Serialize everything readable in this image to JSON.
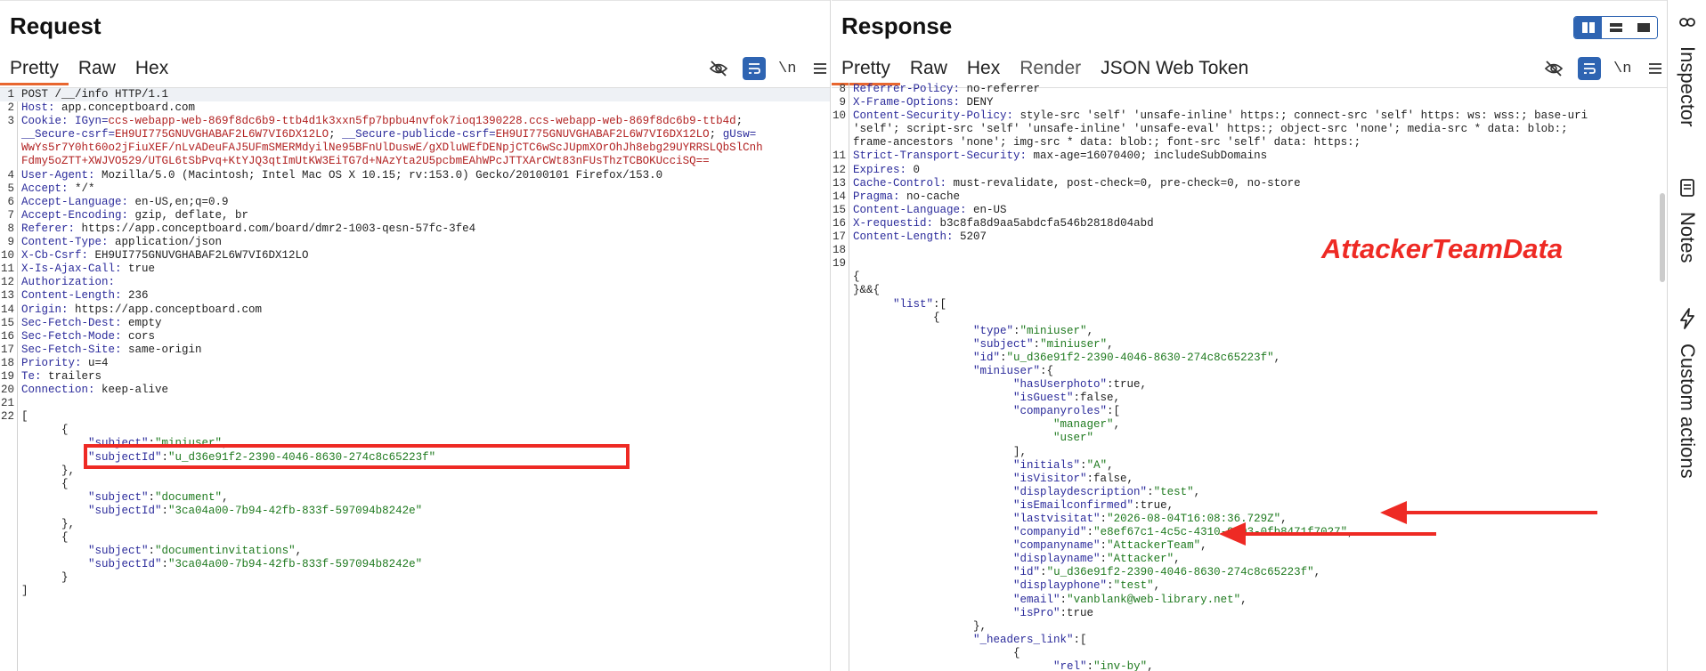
{
  "request": {
    "title": "Request",
    "tabs": [
      "Pretty",
      "Raw",
      "Hex"
    ],
    "newline_label": "\\n",
    "lines": [
      {
        "n": "1",
        "segs": [
          [
            "hv",
            "POST /__/info HTTP/1.1"
          ]
        ],
        "hl": true
      },
      {
        "n": "2",
        "segs": [
          [
            "hk",
            "Host: "
          ],
          [
            "hv",
            "app.conceptboard.com"
          ]
        ]
      },
      {
        "n": "3",
        "segs": [
          [
            "hk",
            "Cookie: "
          ],
          [
            "ck",
            "IGyn="
          ],
          [
            "cv",
            "ccs-webapp-web-869f8dc6b9-ttb4d1k3xxn5fp7bpbu4nvfok7ioq1390228.ccs-webapp-web-869f8dc6b9-ttb4d"
          ],
          [
            "hv",
            "; "
          ]
        ]
      },
      {
        "n": "",
        "segs": [
          [
            "ck",
            "__Secure-csrf="
          ],
          [
            "cv",
            "EH9UI775GNUVGHABAF2L6W7VI6DX12LO"
          ],
          [
            "hv",
            "; "
          ],
          [
            "ck",
            "__Secure-publicde-csrf="
          ],
          [
            "cv",
            "EH9UI775GNUVGHABAF2L6W7VI6DX12LO"
          ],
          [
            "hv",
            "; "
          ],
          [
            "ck",
            "gUsw="
          ]
        ]
      },
      {
        "n": "",
        "segs": [
          [
            "cv",
            "WwYs5r7Y0ht60o2jFiuXEF/nLvADeuFAJ5UFmSMERMdyilNe95BFnUlDuswE/gXDluWEfDENpjCTC6wScJUpmXOrOhJh8ebg29UYRRSLQbSlCnh"
          ]
        ]
      },
      {
        "n": "",
        "segs": [
          [
            "cv",
            "Fdmy5oZTT+XWJVO529/UTGL6tSbPvq+KtYJQ3qtImUtKW3EiTG7d+NAzYta2U5pcbmEAhWPcJTTXArCWt83nFUsThzTCBOKUcciSQ=="
          ]
        ]
      },
      {
        "n": "4",
        "segs": [
          [
            "hk",
            "User-Agent: "
          ],
          [
            "hv",
            "Mozilla/5.0 (Macintosh; Intel Mac OS X 10.15; rv:153.0) Gecko/20100101 Firefox/153.0"
          ]
        ]
      },
      {
        "n": "5",
        "segs": [
          [
            "hk",
            "Accept: "
          ],
          [
            "hv",
            "*/*"
          ]
        ]
      },
      {
        "n": "6",
        "segs": [
          [
            "hk",
            "Accept-Language: "
          ],
          [
            "hv",
            "en-US,en;q=0.9"
          ]
        ]
      },
      {
        "n": "7",
        "segs": [
          [
            "hk",
            "Accept-Encoding: "
          ],
          [
            "hv",
            "gzip, deflate, br"
          ]
        ]
      },
      {
        "n": "8",
        "segs": [
          [
            "hk",
            "Referer: "
          ],
          [
            "hv",
            "https://app.conceptboard.com/board/dmr2-1003-qesn-57fc-3fe4"
          ]
        ]
      },
      {
        "n": "9",
        "segs": [
          [
            "hk",
            "Content-Type: "
          ],
          [
            "hv",
            "application/json"
          ]
        ]
      },
      {
        "n": "10",
        "segs": [
          [
            "hk",
            "X-Cb-Csrf: "
          ],
          [
            "hv",
            "EH9UI775GNUVGHABAF2L6W7VI6DX12LO"
          ]
        ]
      },
      {
        "n": "11",
        "segs": [
          [
            "hk",
            "X-Is-Ajax-Call: "
          ],
          [
            "hv",
            "true"
          ]
        ]
      },
      {
        "n": "12",
        "segs": [
          [
            "hk",
            "Authorization: "
          ]
        ]
      },
      {
        "n": "13",
        "segs": [
          [
            "hk",
            "Content-Length: "
          ],
          [
            "hv",
            "236"
          ]
        ]
      },
      {
        "n": "14",
        "segs": [
          [
            "hk",
            "Origin: "
          ],
          [
            "hv",
            "https://app.conceptboard.com"
          ]
        ]
      },
      {
        "n": "15",
        "segs": [
          [
            "hk",
            "Sec-Fetch-Dest: "
          ],
          [
            "hv",
            "empty"
          ]
        ]
      },
      {
        "n": "16",
        "segs": [
          [
            "hk",
            "Sec-Fetch-Mode: "
          ],
          [
            "hv",
            "cors"
          ]
        ]
      },
      {
        "n": "17",
        "segs": [
          [
            "hk",
            "Sec-Fetch-Site: "
          ],
          [
            "hv",
            "same-origin"
          ]
        ]
      },
      {
        "n": "18",
        "segs": [
          [
            "hk",
            "Priority: "
          ],
          [
            "hv",
            "u=4"
          ]
        ]
      },
      {
        "n": "19",
        "segs": [
          [
            "hk",
            "Te: "
          ],
          [
            "hv",
            "trailers"
          ]
        ]
      },
      {
        "n": "20",
        "segs": [
          [
            "hk",
            "Connection: "
          ],
          [
            "hv",
            "keep-alive"
          ]
        ]
      },
      {
        "n": "21",
        "segs": []
      },
      {
        "n": "22",
        "segs": [
          [
            "jv",
            "["
          ]
        ]
      },
      {
        "n": "",
        "segs": [
          [
            "jv",
            "      {"
          ]
        ]
      },
      {
        "n": "",
        "segs": [
          [
            "jk",
            "          \"subject\""
          ],
          [
            "jv",
            ":"
          ],
          [
            "js",
            "\"miniuser\""
          ],
          [
            "jv",
            ","
          ]
        ]
      },
      {
        "n": "",
        "segs": [
          [
            "jk",
            "          \"subjectId\""
          ],
          [
            "jv",
            ":"
          ],
          [
            "js",
            "\"u_d36e91f2-2390-4046-8630-274c8c65223f\""
          ]
        ]
      },
      {
        "n": "",
        "segs": [
          [
            "jv",
            "      },"
          ]
        ]
      },
      {
        "n": "",
        "segs": [
          [
            "jv",
            "      {"
          ]
        ]
      },
      {
        "n": "",
        "segs": [
          [
            "jk",
            "          \"subject\""
          ],
          [
            "jv",
            ":"
          ],
          [
            "js",
            "\"document\""
          ],
          [
            "jv",
            ","
          ]
        ]
      },
      {
        "n": "",
        "segs": [
          [
            "jk",
            "          \"subjectId\""
          ],
          [
            "jv",
            ":"
          ],
          [
            "js",
            "\"3ca04a00-7b94-42fb-833f-597094b8242e\""
          ]
        ]
      },
      {
        "n": "",
        "segs": [
          [
            "jv",
            "      },"
          ]
        ]
      },
      {
        "n": "",
        "segs": [
          [
            "jv",
            "      {"
          ]
        ]
      },
      {
        "n": "",
        "segs": [
          [
            "jk",
            "          \"subject\""
          ],
          [
            "jv",
            ":"
          ],
          [
            "js",
            "\"documentinvitations\""
          ],
          [
            "jv",
            ","
          ]
        ]
      },
      {
        "n": "",
        "segs": [
          [
            "jk",
            "          \"subjectId\""
          ],
          [
            "jv",
            ":"
          ],
          [
            "js",
            "\"3ca04a00-7b94-42fb-833f-597094b8242e\""
          ]
        ]
      },
      {
        "n": "",
        "segs": [
          [
            "jv",
            "      }"
          ]
        ]
      },
      {
        "n": "",
        "segs": [
          [
            "jv",
            "]"
          ]
        ]
      }
    ]
  },
  "response": {
    "title": "Response",
    "tabs": [
      "Pretty",
      "Raw",
      "Hex",
      "Render",
      "JSON Web Token"
    ],
    "newline_label": "\\n",
    "annotation": "AttackerTeamData",
    "lines": [
      {
        "n": "8",
        "segs": [
          [
            "hk",
            "Referrer-Policy: "
          ],
          [
            "hv",
            "no-referrer"
          ]
        ]
      },
      {
        "n": "9",
        "segs": [
          [
            "hk",
            "X-Frame-Options: "
          ],
          [
            "hv",
            "DENY"
          ]
        ]
      },
      {
        "n": "10",
        "segs": [
          [
            "hk",
            "Content-Security-Policy: "
          ],
          [
            "hv",
            "style-src 'self' 'unsafe-inline' https:; connect-src 'self' https: ws: wss:; base-uri"
          ]
        ]
      },
      {
        "n": "",
        "segs": [
          [
            "hv",
            "'self'; script-src 'self' 'unsafe-inline' 'unsafe-eval' https:; object-src 'none'; media-src * data: blob:;"
          ]
        ]
      },
      {
        "n": "",
        "segs": [
          [
            "hv",
            "frame-ancestors 'none'; img-src * data: blob:; font-src 'self' data: https:;"
          ]
        ]
      },
      {
        "n": "11",
        "segs": [
          [
            "hk",
            "Strict-Transport-Security: "
          ],
          [
            "hv",
            "max-age=16070400; includeSubDomains"
          ]
        ]
      },
      {
        "n": "12",
        "segs": [
          [
            "hk",
            "Expires: "
          ],
          [
            "hv",
            "0"
          ]
        ]
      },
      {
        "n": "13",
        "segs": [
          [
            "hk",
            "Cache-Control: "
          ],
          [
            "hv",
            "must-revalidate, post-check=0, pre-check=0, no-store"
          ]
        ]
      },
      {
        "n": "14",
        "segs": [
          [
            "hk",
            "Pragma: "
          ],
          [
            "hv",
            "no-cache"
          ]
        ]
      },
      {
        "n": "15",
        "segs": [
          [
            "hk",
            "Content-Language: "
          ],
          [
            "hv",
            "en-US"
          ]
        ]
      },
      {
        "n": "16",
        "segs": [
          [
            "hk",
            "X-requestid: "
          ],
          [
            "hv",
            "b3c8fa8d9aa5abdcfa546b2818d04abd"
          ]
        ]
      },
      {
        "n": "17",
        "segs": [
          [
            "hk",
            "Content-Length: "
          ],
          [
            "hv",
            "5207"
          ]
        ]
      },
      {
        "n": "18",
        "segs": []
      },
      {
        "n": "19",
        "segs": []
      },
      {
        "n": "",
        "segs": [
          [
            "jv",
            "{"
          ]
        ]
      },
      {
        "n": "",
        "segs": [
          [
            "jv",
            "}&&{"
          ]
        ]
      },
      {
        "n": "",
        "segs": [
          [
            "jk",
            "      \"list\""
          ],
          [
            "jv",
            ":["
          ]
        ]
      },
      {
        "n": "",
        "segs": [
          [
            "jv",
            "            {"
          ]
        ]
      },
      {
        "n": "",
        "segs": [
          [
            "jk",
            "                  \"type\""
          ],
          [
            "jv",
            ":"
          ],
          [
            "js",
            "\"miniuser\""
          ],
          [
            "jv",
            ","
          ]
        ]
      },
      {
        "n": "",
        "segs": [
          [
            "jk",
            "                  \"subject\""
          ],
          [
            "jv",
            ":"
          ],
          [
            "js",
            "\"miniuser\""
          ],
          [
            "jv",
            ","
          ]
        ]
      },
      {
        "n": "",
        "segs": [
          [
            "jk",
            "                  \"id\""
          ],
          [
            "jv",
            ":"
          ],
          [
            "js",
            "\"u_d36e91f2-2390-4046-8630-274c8c65223f\""
          ],
          [
            "jv",
            ","
          ]
        ]
      },
      {
        "n": "",
        "segs": [
          [
            "jk",
            "                  \"miniuser\""
          ],
          [
            "jv",
            ":{"
          ]
        ]
      },
      {
        "n": "",
        "segs": [
          [
            "jk",
            "                        \"hasUserphoto\""
          ],
          [
            "jv",
            ":true,"
          ]
        ]
      },
      {
        "n": "",
        "segs": [
          [
            "jk",
            "                        \"isGuest\""
          ],
          [
            "jv",
            ":false,"
          ]
        ]
      },
      {
        "n": "",
        "segs": [
          [
            "jk",
            "                        \"companyroles\""
          ],
          [
            "jv",
            ":["
          ]
        ]
      },
      {
        "n": "",
        "segs": [
          [
            "js",
            "                              \"manager\""
          ],
          [
            "jv",
            ","
          ]
        ]
      },
      {
        "n": "",
        "segs": [
          [
            "js",
            "                              \"user\""
          ]
        ]
      },
      {
        "n": "",
        "segs": [
          [
            "jv",
            "                        ],"
          ]
        ]
      },
      {
        "n": "",
        "segs": [
          [
            "jk",
            "                        \"initials\""
          ],
          [
            "jv",
            ":"
          ],
          [
            "js",
            "\"A\""
          ],
          [
            "jv",
            ","
          ]
        ]
      },
      {
        "n": "",
        "segs": [
          [
            "jk",
            "                        \"isVisitor\""
          ],
          [
            "jv",
            ":false,"
          ]
        ]
      },
      {
        "n": "",
        "segs": [
          [
            "jk",
            "                        \"displaydescription\""
          ],
          [
            "jv",
            ":"
          ],
          [
            "js",
            "\"test\""
          ],
          [
            "jv",
            ","
          ]
        ]
      },
      {
        "n": "",
        "segs": [
          [
            "jk",
            "                        \"isEmailconfirmed\""
          ],
          [
            "jv",
            ":true,"
          ]
        ]
      },
      {
        "n": "",
        "segs": [
          [
            "jk",
            "                        \"lastvisitat\""
          ],
          [
            "jv",
            ":"
          ],
          [
            "js",
            "\"2026-08-04T16:08:36.729Z\""
          ],
          [
            "jv",
            ","
          ]
        ]
      },
      {
        "n": "",
        "segs": [
          [
            "jk",
            "                        \"companyid\""
          ],
          [
            "jv",
            ":"
          ],
          [
            "js",
            "\"e8ef67c1-4c5c-4310-9a03-0fb8471f7027\""
          ],
          [
            "jv",
            ","
          ]
        ]
      },
      {
        "n": "",
        "segs": [
          [
            "jk",
            "                        \"companyname\""
          ],
          [
            "jv",
            ":"
          ],
          [
            "js",
            "\"AttackerTeam\""
          ],
          [
            "jv",
            ","
          ]
        ]
      },
      {
        "n": "",
        "segs": [
          [
            "jk",
            "                        \"displayname\""
          ],
          [
            "jv",
            ":"
          ],
          [
            "js",
            "\"Attacker\""
          ],
          [
            "jv",
            ","
          ]
        ]
      },
      {
        "n": "",
        "segs": [
          [
            "jk",
            "                        \"id\""
          ],
          [
            "jv",
            ":"
          ],
          [
            "js",
            "\"u_d36e91f2-2390-4046-8630-274c8c65223f\""
          ],
          [
            "jv",
            ","
          ]
        ]
      },
      {
        "n": "",
        "segs": [
          [
            "jk",
            "                        \"displayphone\""
          ],
          [
            "jv",
            ":"
          ],
          [
            "js",
            "\"test\""
          ],
          [
            "jv",
            ","
          ]
        ]
      },
      {
        "n": "",
        "segs": [
          [
            "jk",
            "                        \"email\""
          ],
          [
            "jv",
            ":"
          ],
          [
            "js",
            "\"vanblank@web-library.net\""
          ],
          [
            "jv",
            ","
          ]
        ]
      },
      {
        "n": "",
        "segs": [
          [
            "jk",
            "                        \"isPro\""
          ],
          [
            "jv",
            ":true"
          ]
        ]
      },
      {
        "n": "",
        "segs": [
          [
            "jv",
            "                  },"
          ]
        ]
      },
      {
        "n": "",
        "segs": [
          [
            "jk",
            "                  \"_headers_link\""
          ],
          [
            "jv",
            ":["
          ]
        ]
      },
      {
        "n": "",
        "segs": [
          [
            "jv",
            "                        {"
          ]
        ]
      },
      {
        "n": "",
        "segs": [
          [
            "jk",
            "                              \"rel\""
          ],
          [
            "jv",
            ":"
          ],
          [
            "js",
            "\"inv-by\""
          ],
          [
            "jv",
            ","
          ]
        ]
      },
      {
        "n": "",
        "segs": [
          [
            "jk",
            "                              \"linkParams\""
          ],
          [
            "jv",
            ":{"
          ]
        ]
      }
    ]
  },
  "sidebar": {
    "items": [
      "Inspector",
      "Notes",
      "Custom actions"
    ]
  }
}
